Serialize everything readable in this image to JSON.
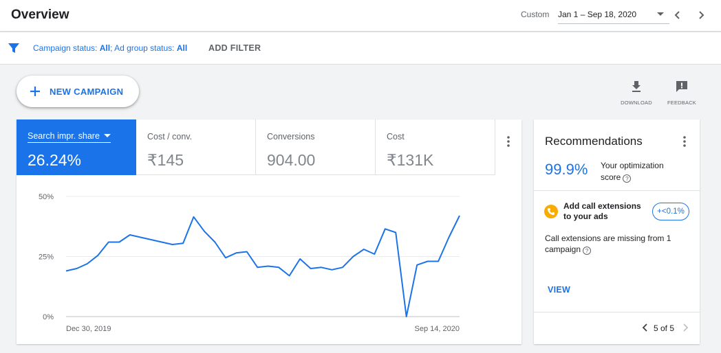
{
  "header": {
    "title": "Overview",
    "range_label": "Custom",
    "range_value": "Jan 1 – Sep 18, 2020"
  },
  "filter": {
    "campaign_status_label": "Campaign status:",
    "campaign_status_value": "All",
    "separator": ";",
    "ad_group_status_label": "Ad group status:",
    "ad_group_status_value": "All",
    "add_filter": "ADD FILTER"
  },
  "actions": {
    "new_campaign": "NEW CAMPAIGN",
    "download": "DOWNLOAD",
    "feedback": "FEEDBACK"
  },
  "metrics": [
    {
      "label": "Search impr. share",
      "value": "26.24%",
      "active": true
    },
    {
      "label": "Cost / conv.",
      "value": "₹145",
      "active": false
    },
    {
      "label": "Conversions",
      "value": "904.00",
      "active": false
    },
    {
      "label": "Cost",
      "value": "₹131K",
      "active": false
    }
  ],
  "colors": {
    "accent": "#1a73e8",
    "badge": "#f9ab00"
  },
  "chart_data": {
    "type": "line",
    "series": [
      {
        "values": [
          19,
          20,
          22,
          25.5,
          31,
          31,
          34,
          33,
          32,
          31,
          30,
          30.5,
          41.5,
          35.5,
          31,
          24.5,
          26.5,
          27,
          20.5,
          21,
          20.5,
          17,
          24,
          20,
          20.5,
          19.5,
          20.5,
          25,
          28,
          26,
          36.5,
          35,
          0,
          21.5,
          23,
          23,
          33,
          42
        ]
      }
    ],
    "x_tick_labels": [
      "Dec 30, 2019",
      "Sep 14, 2020"
    ],
    "y_ticks": [
      "50%",
      "25%",
      "0%"
    ],
    "ylim": [
      0,
      50
    ],
    "grid": true
  },
  "recommendations": {
    "title": "Recommendations",
    "score": "99.9%",
    "score_label": "Your optimization score",
    "help_glyph": "?",
    "item_title": "Add call extensions to your ads",
    "uplift": "+<0.1%",
    "item_description": "Call extensions are missing from 1 campaign",
    "view": "VIEW",
    "pager": "5 of 5"
  }
}
